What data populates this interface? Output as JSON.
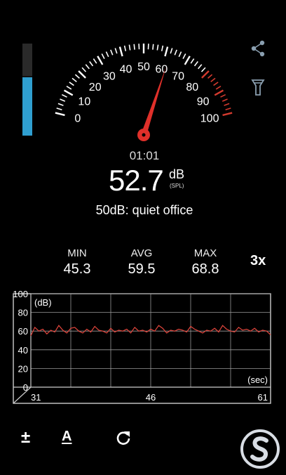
{
  "meter": {
    "level_fraction": 0.63,
    "current_db": 52.7,
    "needle_db": 62,
    "scale_labels": [
      "0",
      "10",
      "20",
      "30",
      "40",
      "50",
      "60",
      "70",
      "80",
      "90",
      "100"
    ],
    "red_zone_from": 80
  },
  "timer": "01:01",
  "reading": {
    "value": "52.7",
    "unit": "dB",
    "unit_sub": "(SPL)"
  },
  "description": "50dB: quiet office",
  "stats": {
    "min_label": "MIN",
    "min_value": "45.3",
    "avg_label": "AVG",
    "avg_value": "59.5",
    "max_label": "MAX",
    "max_value": "68.8",
    "zoom": "3x"
  },
  "chart_data": {
    "type": "line",
    "ylabel": "(dB)",
    "xlabel": "(sec)",
    "ylim": [
      0,
      100
    ],
    "y_ticks": [
      "0",
      "20",
      "40",
      "60",
      "80",
      "100"
    ],
    "x_ticks": [
      "31",
      "46",
      "61"
    ],
    "grid": true,
    "series": [
      {
        "color": "#e0453c",
        "x": [
          31,
          31.5,
          32,
          32.5,
          33,
          33.5,
          34,
          34.5,
          35,
          35.5,
          36,
          36.5,
          37,
          37.5,
          38,
          38.5,
          39,
          39.5,
          40,
          40.5,
          41,
          41.5,
          42,
          42.5,
          43,
          43.5,
          44,
          44.5,
          45,
          45.5,
          46,
          46.5,
          47,
          47.5,
          48,
          48.5,
          49,
          49.5,
          50,
          50.5,
          51,
          51.5,
          52,
          52.5,
          53,
          53.5,
          54,
          54.5,
          55,
          55.5,
          56,
          56.5,
          57,
          57.5,
          58,
          58.5,
          59,
          59.5,
          60,
          60.5,
          61
        ],
        "values": [
          55,
          64,
          60,
          62,
          57,
          61,
          59,
          66,
          61,
          58,
          63,
          64,
          60,
          58,
          62,
          59,
          65,
          61,
          60,
          58,
          63,
          59,
          61,
          60,
          62,
          58,
          64,
          60,
          61,
          59,
          62,
          60,
          66,
          63,
          58,
          61,
          60,
          62,
          61,
          59,
          65,
          62,
          60,
          58,
          61,
          60,
          63,
          59,
          66,
          62,
          60,
          59,
          64,
          61,
          62,
          60,
          63,
          59,
          61,
          60,
          56
        ]
      }
    ]
  },
  "icons": {
    "share": "share-icon",
    "flashlight": "flashlight-icon",
    "calibrate": "plus-minus-icon",
    "weighting": "a-weighting-icon",
    "reset": "reset-icon"
  },
  "labels": {
    "plusminus": "±",
    "weighting": "A"
  },
  "colors": {
    "accent": "#2f9fd0",
    "needle": "#e0302a",
    "redzone": "#d33a2e",
    "trace": "#e0453c"
  }
}
